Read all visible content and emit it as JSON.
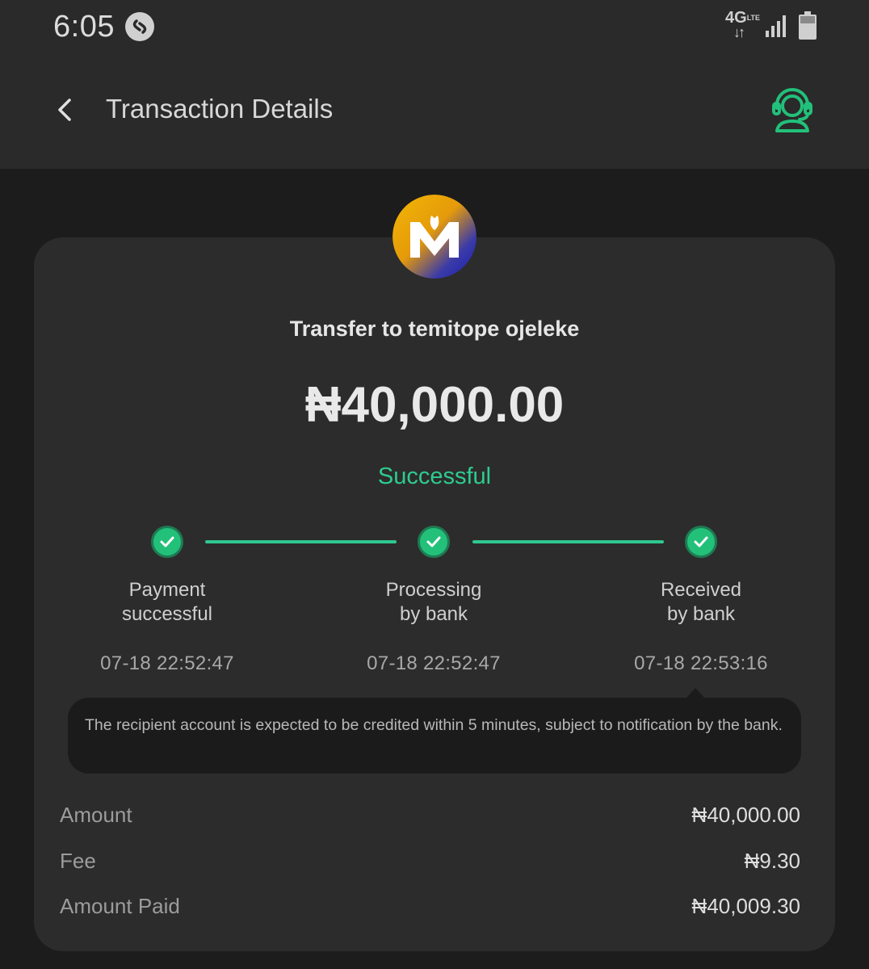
{
  "status_bar": {
    "time": "6:05",
    "network": "4G",
    "network_sub": "LTE"
  },
  "header": {
    "title": "Transaction Details"
  },
  "transaction": {
    "title": "Transfer to temitope ojeleke",
    "amount": "₦40,000.00",
    "status": "Successful"
  },
  "steps": [
    {
      "line1": "Payment",
      "line2": "successful",
      "time": "07-18 22:52:47"
    },
    {
      "line1": "Processing",
      "line2": "by bank",
      "time": "07-18 22:52:47"
    },
    {
      "line1": "Received",
      "line2": "by bank",
      "time": "07-18 22:53:16"
    }
  ],
  "notice": "The recipient account is expected to be credited within 5 minutes, subject to notification by the bank.",
  "details": [
    {
      "label": "Amount",
      "value": "₦40,000.00"
    },
    {
      "label": "Fee",
      "value": "₦9.30"
    },
    {
      "label": "Amount Paid",
      "value": "₦40,009.30"
    }
  ],
  "colors": {
    "accent_green": "#2ecc8f",
    "check_green": "#23c07a",
    "card_bg": "#2c2c2c",
    "header_bg": "#2a2a2a"
  },
  "icons": {
    "back": "chevron-left-icon",
    "support": "headset-support-icon",
    "check": "check-icon"
  }
}
